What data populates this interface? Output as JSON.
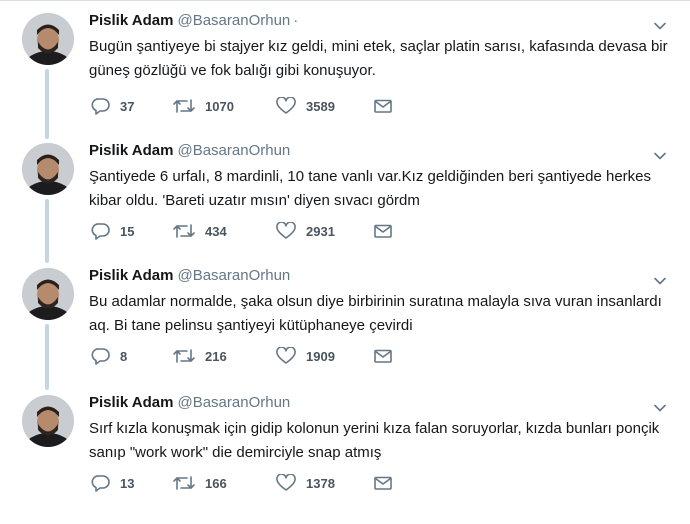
{
  "tweets": [
    {
      "author": "Pislik Adam",
      "handle": "@BasaranOrhun",
      "separator": "·",
      "text": "Bugün şantiyeye bi stajyer kız geldi, mini etek, saçlar platin sarısı, kafasında devasa bir güneş gözlüğü ve fok balığı gibi konuşuyor.",
      "replies": "37",
      "retweets": "1070",
      "likes": "3589"
    },
    {
      "author": "Pislik Adam",
      "handle": "@BasaranOrhun",
      "text": "Şantiyede 6 urfalı, 8 mardinli, 10 tane vanlı var.Kız geldiğinden beri şantiyede herkes kibar oldu. 'Bareti uzatır mısın' diyen sıvacı gördm",
      "replies": "15",
      "retweets": "434",
      "likes": "2931"
    },
    {
      "author": "Pislik Adam",
      "handle": "@BasaranOrhun",
      "text": "Bu adamlar normalde, şaka olsun diye birbirinin suratına malayla sıva vuran insanlardı aq. Bi tane pelinsu şantiyeyi kütüphaneye çevirdi",
      "replies": "8",
      "retweets": "216",
      "likes": "1909"
    },
    {
      "author": "Pislik Adam",
      "handle": "@BasaranOrhun",
      "text": "Sırf kızla konuşmak için gidip kolonun yerini kıza falan soruyorlar, kızda bunları ponçik sanıp \"work work\" die demirciyle snap atmış",
      "replies": "13",
      "retweets": "166",
      "likes": "1378"
    }
  ],
  "icons": {
    "reply": "reply-icon",
    "retweet": "retweet-icon",
    "like": "heart-icon",
    "dm": "envelope-icon",
    "menu": "chevron-down-icon"
  },
  "colors": {
    "text": "#14171a",
    "secondary": "#657786",
    "thread_line": "#c4d6e2"
  }
}
